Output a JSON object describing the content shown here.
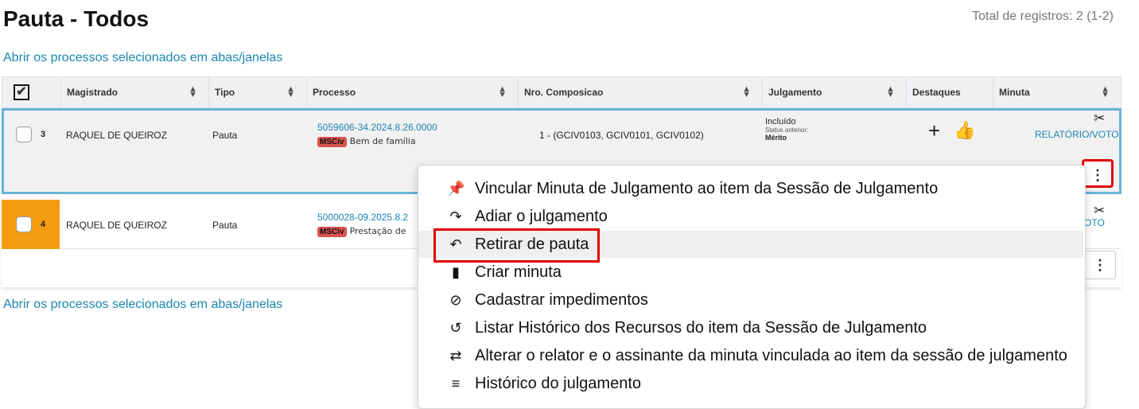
{
  "page": {
    "title": "Pauta - Todos",
    "total": "Total de registros: 2 (1-2)",
    "open_link_top": "Abrir os processos selecionados em abas/janelas",
    "open_link_bottom": "Abrir os processos selecionados em abas/janelas"
  },
  "table": {
    "select_all_glyph": "✔",
    "headers": {
      "magistrado": "Magistrado",
      "tipo": "Tipo",
      "processo": "Processo",
      "composicao": "Nro. Composicao",
      "julgamento": "Julgamento",
      "destaques": "Destaques",
      "minuta": "Minuta"
    },
    "rows": [
      {
        "num": "3",
        "magistrado": "RAQUEL DE QUEIROZ",
        "tipo": "Pauta",
        "processo": "5059606-34.2024.8.26.0000",
        "tag": "MSCiv",
        "assunto": "Bem de família",
        "composicao": "1 - (GCIV0103, GCIV0101, GCIV0102)",
        "julgamento": "Incluído",
        "status_anterior_label": "Status anterior:",
        "status_anterior": "Mérito",
        "minuta": "RELATÓRIO/VOTO"
      },
      {
        "num": "4",
        "magistrado": "RAQUEL DE QUEIROZ",
        "tipo": "Pauta",
        "processo": "5000028-09.2025.8.2",
        "tag": "MSCiv",
        "assunto": "Prestação de",
        "minuta": "OTO"
      }
    ]
  },
  "menu": {
    "items": [
      {
        "icon": "pin-icon",
        "glyph": "📌",
        "label": "Vincular Minuta de Julgamento ao item da Sessão de Julgamento"
      },
      {
        "icon": "redo-arrow-icon",
        "glyph": "↷",
        "label": "Adiar o julgamento"
      },
      {
        "icon": "undo-arrow-icon",
        "glyph": "↶",
        "label": "Retirar de pauta"
      },
      {
        "icon": "file-icon",
        "glyph": "▮",
        "label": "Criar minuta"
      },
      {
        "icon": "prohibited-icon",
        "glyph": "⊘",
        "label": "Cadastrar impedimentos"
      },
      {
        "icon": "history-icon",
        "glyph": "↺",
        "label": "Listar Histórico dos Recursos do item da Sessão de Julgamento"
      },
      {
        "icon": "swap-arrows-icon",
        "glyph": "⇄",
        "label": "Alterar o relator e o assinante da minuta vinculada ao item da sessão de julgamento"
      },
      {
        "icon": "list-icon",
        "glyph": "≡",
        "label": "Histórico do julgamento"
      }
    ]
  },
  "colors": {
    "link": "#1a86b0",
    "highlight_red": "#e10000",
    "row_selected_border": "#69b2d6",
    "row_flag_orange": "#f39c12",
    "tag_red": "#d9534f"
  }
}
